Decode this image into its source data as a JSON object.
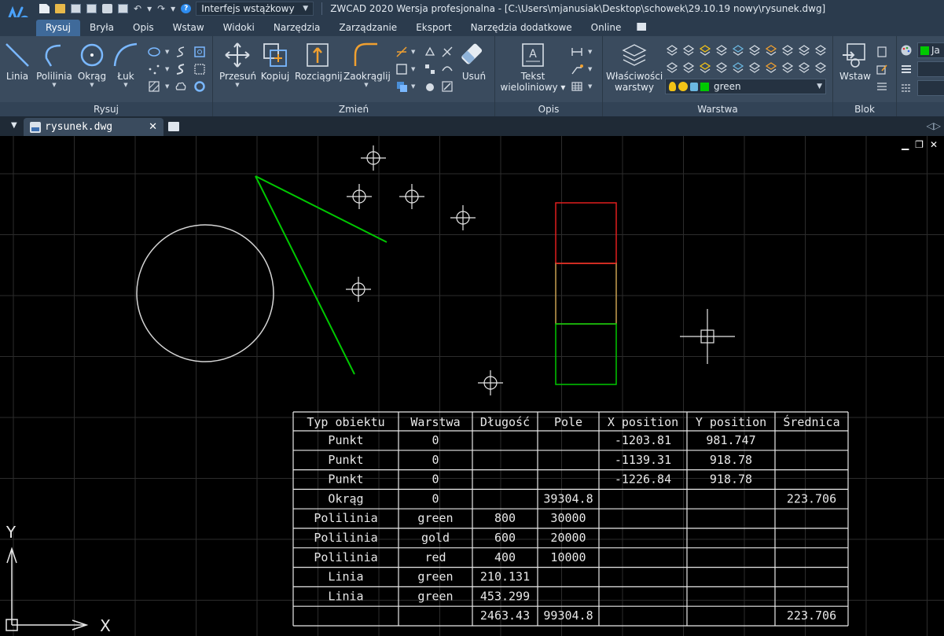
{
  "titlebar": {
    "workspace": "Interfejs wstążkowy",
    "title": "ZWCAD 2020 Wersja profesjonalna - [C:\\Users\\mjanusiak\\Desktop\\schowek\\29.10.19 nowy\\rysunek.dwg]",
    "help_glyph": "?"
  },
  "menu_tabs": [
    "Rysuj",
    "Bryła",
    "Opis",
    "Wstaw",
    "Widoki",
    "Narzędzia",
    "Zarządzanie",
    "Eksport",
    "Narzędzia dodatkowe",
    "Online"
  ],
  "ribbon": {
    "rysuj": {
      "title": "Rysuj",
      "linia": "Linia",
      "polilinia": "Polilinia",
      "okrag": "Okrąg",
      "luk": "Łuk"
    },
    "zmien": {
      "title": "Zmień",
      "przesun": "Przesuń",
      "kopiuj": "Kopiuj",
      "rozciagnij": "Rozciągnij",
      "zaokraglij": "Zaokrąglij",
      "usun": "Usuń"
    },
    "opis": {
      "title": "Opis",
      "tekst_line1": "Tekst",
      "tekst_line2": "wieloliniowy"
    },
    "warstwa": {
      "title": "Warstwa",
      "props_line1": "Właściwości",
      "props_line2": "warstwy",
      "current_layer": "green"
    },
    "blok": {
      "title": "Blok",
      "wstaw": "Wstaw"
    },
    "extra": {
      "label": "Ja"
    }
  },
  "doc_tab": {
    "name": "rysunek.dwg",
    "close": "✕"
  },
  "colors": {
    "green": "#00c800",
    "red": "#e01e1e",
    "gold": "#c8a050",
    "circle": "#d6d6d6",
    "grid_minor": "#1e1e1e",
    "grid_major": "#2c2c2c"
  },
  "ucs": {
    "x_label": "X",
    "y_label": "Y"
  },
  "table": {
    "headers": [
      "Typ obiektu",
      "Warstwa",
      "Długość",
      "Pole",
      "X position",
      "Y position",
      "Średnica"
    ],
    "rows": [
      [
        "Punkt",
        "0",
        "",
        "",
        "-1203.81",
        "981.747",
        ""
      ],
      [
        "Punkt",
        "0",
        "",
        "",
        "-1139.31",
        "918.78",
        ""
      ],
      [
        "Punkt",
        "0",
        "",
        "",
        "-1226.84",
        "918.78",
        ""
      ],
      [
        "Okrąg",
        "0",
        "",
        "39304.8",
        "",
        "",
        "223.706"
      ],
      [
        "Polilinia",
        "green",
        "800",
        "30000",
        "",
        "",
        ""
      ],
      [
        "Polilinia",
        "gold",
        "600",
        "20000",
        "",
        "",
        ""
      ],
      [
        "Polilinia",
        "red",
        "400",
        "10000",
        "",
        "",
        ""
      ],
      [
        "Linia",
        "green",
        "210.131",
        "",
        "",
        "",
        ""
      ],
      [
        "Linia",
        "green",
        "453.299",
        "",
        "",
        "",
        ""
      ],
      [
        "",
        "",
        "2463.43",
        "99304.8",
        "",
        "",
        "223.706"
      ]
    ]
  }
}
